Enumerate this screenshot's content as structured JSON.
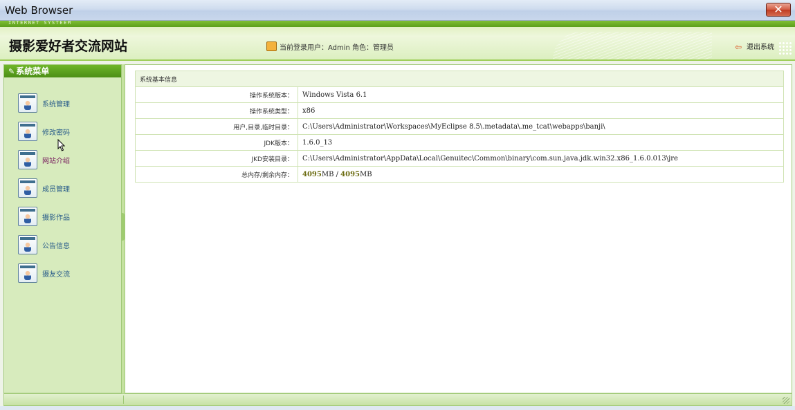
{
  "window": {
    "title": "Web Browser",
    "close_label": "✕"
  },
  "header": {
    "tagline": "INTERNET SYSTEEM",
    "site_title": "摄影爱好者交流网站",
    "user_info": "当前登录用户：Admin 角色：管理员",
    "logout_label": "退出系统"
  },
  "sidebar": {
    "title": "系统菜单",
    "items": [
      {
        "label": "系统管理",
        "icon": "user-card-icon"
      },
      {
        "label": "修改密码",
        "icon": "user-card-icon"
      },
      {
        "label": "网站介绍",
        "icon": "user-card-icon",
        "visited": true
      },
      {
        "label": "成员管理",
        "icon": "user-card-icon"
      },
      {
        "label": "摄影作品",
        "icon": "user-card-icon"
      },
      {
        "label": "公告信息",
        "icon": "user-card-icon"
      },
      {
        "label": "摄友交流",
        "icon": "user-card-icon"
      }
    ]
  },
  "info": {
    "caption": "系统基本信息",
    "rows": [
      {
        "label": "操作系统版本：",
        "value": "Windows Vista  6.1"
      },
      {
        "label": "操作系统类型：",
        "value": "x86"
      },
      {
        "label": "用户,目录,临时目录：",
        "value": "C:\\Users\\Administrator\\Workspaces\\MyEclipse 8.5\\.metadata\\.me_tcat\\webapps\\banji\\"
      },
      {
        "label": "JDK版本：",
        "value": "1.6.0_13"
      },
      {
        "label": "JKD安装目录：",
        "value": "C:\\Users\\Administrator\\AppData\\Local\\Genuitec\\Common\\binary\\com.sun.java.jdk.win32.x86_1.6.0.013\\jre"
      }
    ],
    "memory": {
      "label": "总内存/剩余内存：",
      "total": "4095",
      "total_unit": "MB",
      "separator": " / ",
      "free": "4095",
      "free_unit": "MB"
    }
  },
  "colors": {
    "accent": "#5c9e1c",
    "sidebar_bg": "#d7ebbd",
    "link": "#2a5d8a"
  }
}
